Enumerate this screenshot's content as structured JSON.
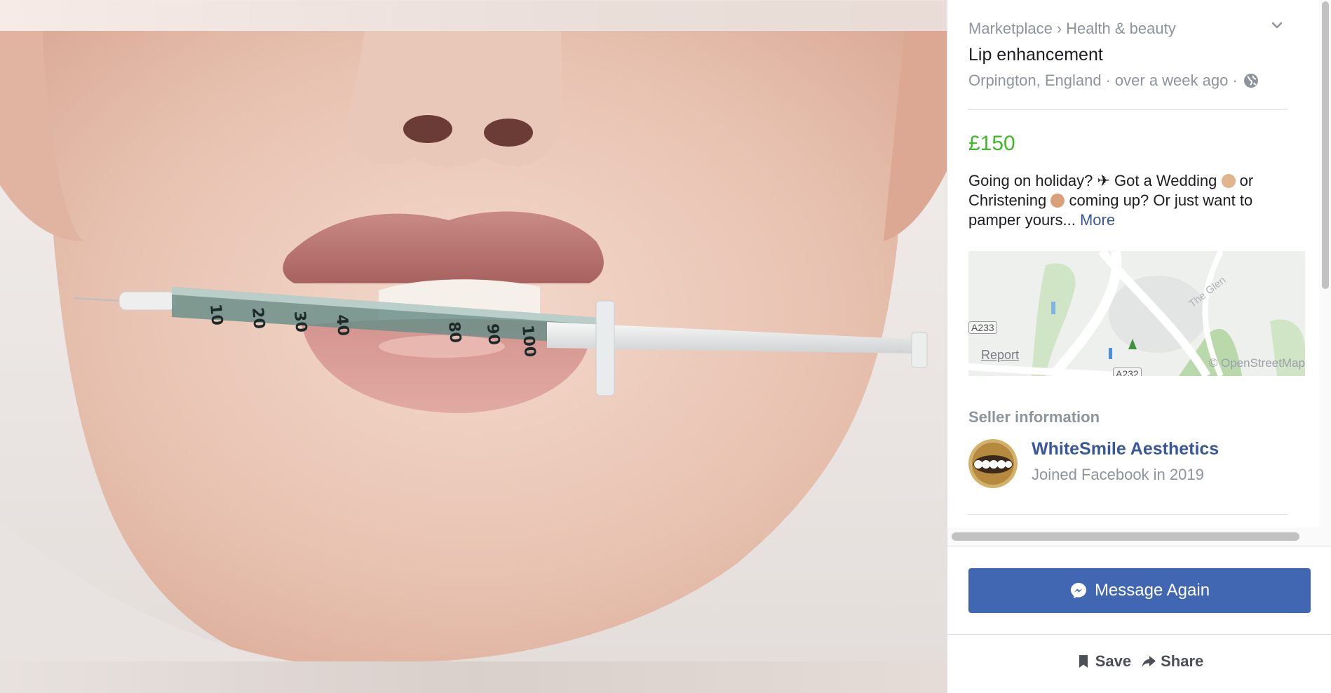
{
  "photo": {
    "alt_name": "lip-syringe-photo"
  },
  "breadcrumb": {
    "root": "Marketplace",
    "separator": "›",
    "category": "Health & beauty"
  },
  "listing": {
    "title": "Lip enhancement",
    "location": "Orpington, England",
    "posted": "over a week ago",
    "price": "£150",
    "description_part1": "Going on holiday? ✈ Got a Wedding",
    "description_part2": " or Christening",
    "description_part3": " coming up? Or just want to pamper yours...",
    "more_label": "More"
  },
  "map": {
    "report_label": "Report",
    "road_a233": "A233",
    "road_a232": "A232",
    "street_label": "The Glen",
    "attribution": "© OpenStreetMap"
  },
  "seller": {
    "heading": "Seller information",
    "name": "WhiteSmile Aesthetics",
    "joined": "Joined Facebook in 2019"
  },
  "actions": {
    "message_label": "Message Again",
    "save_label": "Save",
    "share_label": "Share"
  },
  "colors": {
    "price": "#42b72a",
    "primary_button": "#4267b2",
    "link": "#385898",
    "muted_text": "#8d949e"
  }
}
